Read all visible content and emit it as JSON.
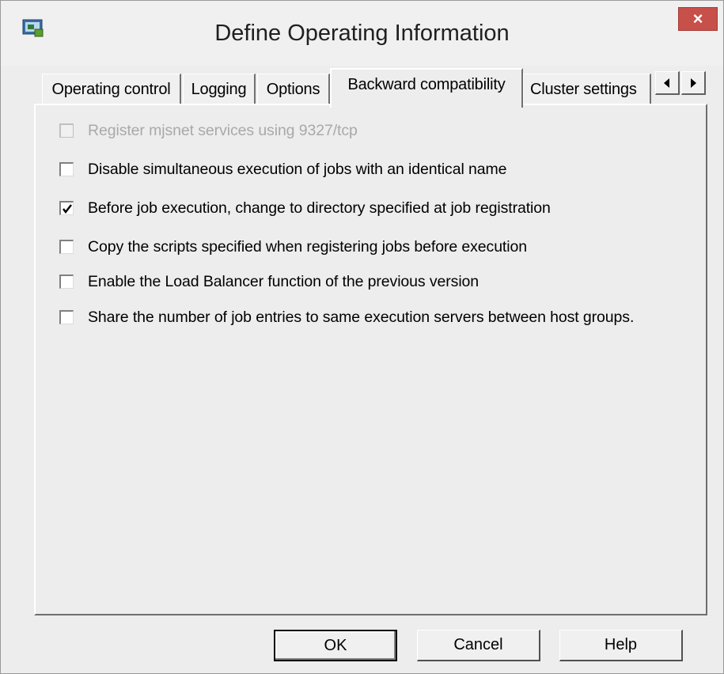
{
  "window": {
    "title": "Define Operating Information",
    "close_label": "×"
  },
  "tabs": [
    {
      "label": "Operating control",
      "active": false
    },
    {
      "label": "Logging",
      "active": false
    },
    {
      "label": "Options",
      "active": false
    },
    {
      "label": "Backward compatibility",
      "active": true
    },
    {
      "label": "Cluster settings",
      "active": false
    }
  ],
  "options": [
    {
      "label": "Register mjsnet services using 9327/tcp",
      "checked": false,
      "enabled": false
    },
    {
      "label": "Disable simultaneous execution of jobs with an identical name",
      "checked": false,
      "enabled": true
    },
    {
      "label": "Before job execution, change to directory specified at job registration",
      "checked": true,
      "enabled": true
    },
    {
      "label": "Copy the scripts specified when registering jobs before execution",
      "checked": false,
      "enabled": true
    },
    {
      "label": "Enable the Load Balancer function of the previous version",
      "checked": false,
      "enabled": true
    },
    {
      "label": "Share the number of job entries to same execution servers between host groups.",
      "checked": false,
      "enabled": true
    }
  ],
  "buttons": {
    "ok": "OK",
    "cancel": "Cancel",
    "help": "Help"
  }
}
